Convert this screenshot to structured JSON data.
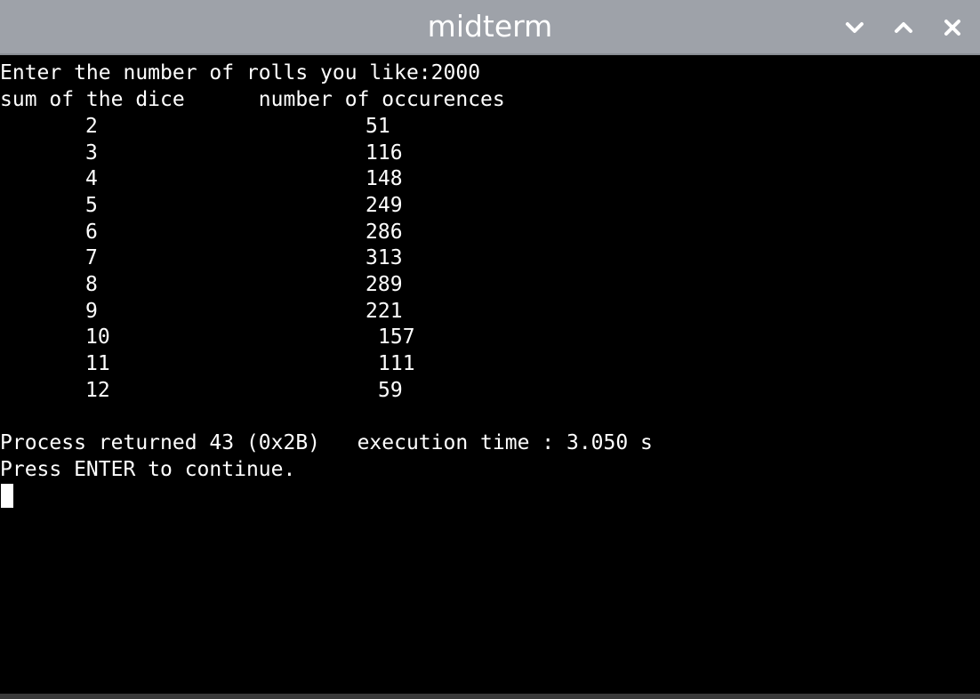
{
  "window": {
    "title": "midterm"
  },
  "terminal": {
    "prompt_line": "Enter the number of rolls you like:2000",
    "header_line": "sum of the dice      number of occurences",
    "rows": [
      {
        "sum": "2",
        "count": "51"
      },
      {
        "sum": "3",
        "count": "116"
      },
      {
        "sum": "4",
        "count": "148"
      },
      {
        "sum": "5",
        "count": "249"
      },
      {
        "sum": "6",
        "count": "286"
      },
      {
        "sum": "7",
        "count": "313"
      },
      {
        "sum": "8",
        "count": "289"
      },
      {
        "sum": "9",
        "count": "221"
      },
      {
        "sum": "10",
        "count": "157"
      },
      {
        "sum": "11",
        "count": "111"
      },
      {
        "sum": "12",
        "count": "59"
      }
    ],
    "process_line": "Process returned 43 (0x2B)   execution time : 3.050 s",
    "continue_line": "Press ENTER to continue."
  },
  "icons": {
    "minimize": "chevron-down-icon",
    "maximize": "chevron-up-icon",
    "close": "close-icon"
  },
  "colors": {
    "titlebar": "#9ea2a9",
    "terminal_bg": "#000000",
    "terminal_fg": "#ffffff"
  }
}
